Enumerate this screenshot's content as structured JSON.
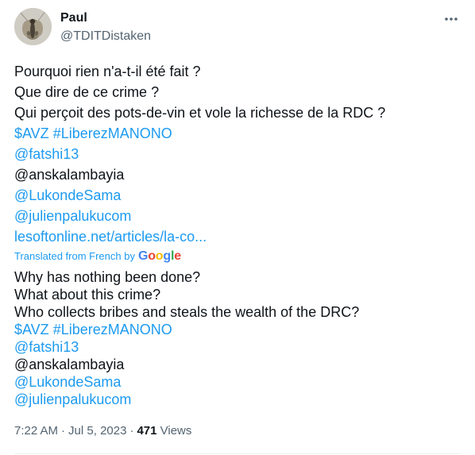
{
  "author": {
    "display_name": "Paul",
    "handle": "@TDITDistaken",
    "avatar_icon": "moth-avatar-icon"
  },
  "more_icon": "more-horizontal-icon",
  "original_text": {
    "lines": [
      "Pourquoi rien n'a-t-il été fait ?",
      "Que dire de ce crime ?",
      "Qui perçoit des pots-de-vin et vole la richesse de la RDC ?"
    ],
    "cashtag": "$AVZ",
    "hashtag": "#LiberezMANONO",
    "mentions": [
      "@fatshi13",
      "@anskalambayia",
      "@LukondeSama",
      "@julienpalukucom"
    ],
    "link": "lesoftonline.net/articles/la-co..."
  },
  "translation": {
    "label": "Translated from French by",
    "provider": "Google",
    "lines": [
      "Why has nothing been done?",
      "What about this crime?",
      "Who collects bribes and steals the wealth of the DRC?"
    ],
    "cashtag": "$AVZ",
    "hashtag": "#LiberezMANONO",
    "mentions": [
      "@fatshi13",
      "@anskalambayia",
      "@LukondeSama",
      "@julienpalukucom"
    ]
  },
  "meta": {
    "time": "7:22 AM",
    "separator": "·",
    "date": "Jul 5, 2023",
    "views_count": "471",
    "views_label": "Views"
  },
  "colors": {
    "link": "#1d9bf0",
    "text": "#0f1419",
    "secondary": "#536471",
    "google_blue": "#4285f4",
    "google_red": "#ea4335",
    "google_yellow": "#fbbc05",
    "google_green": "#34a853"
  }
}
